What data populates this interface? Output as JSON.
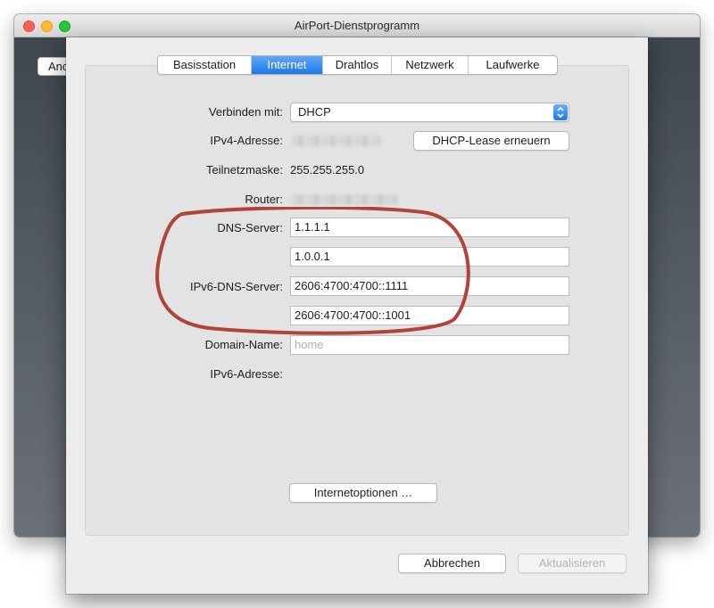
{
  "window": {
    "title": "AirPort-Dienstprogramm",
    "background_button_label": "Anc"
  },
  "tabs": [
    {
      "label": "Basisstation",
      "active": false
    },
    {
      "label": "Internet",
      "active": true
    },
    {
      "label": "Drahtlos",
      "active": false
    },
    {
      "label": "Netzwerk",
      "active": false
    },
    {
      "label": "Laufwerke",
      "active": false
    }
  ],
  "form": {
    "connect_with": {
      "label": "Verbinden mit:",
      "value": "DHCP"
    },
    "ipv4": {
      "label": "IPv4-Adresse:",
      "value_hidden": true
    },
    "renew_button": "DHCP-Lease erneuern",
    "subnet": {
      "label": "Teilnetzmaske:",
      "value": "255.255.255.0"
    },
    "router": {
      "label": "Router:",
      "value_hidden": true
    },
    "dns": {
      "label": "DNS-Server:",
      "values": [
        "1.1.1.1",
        "1.0.0.1"
      ]
    },
    "ipv6_dns": {
      "label": "IPv6-DNS-Server:",
      "values": [
        "2606:4700:4700::1111",
        "2606:4700:4700::1001"
      ]
    },
    "domain": {
      "label": "Domain-Name:",
      "placeholder": "home"
    },
    "ipv6_address": {
      "label": "IPv6-Adresse:"
    }
  },
  "buttons": {
    "internet_options": "Internetoptionen …",
    "cancel": "Abbrechen",
    "update": "Aktualisieren"
  },
  "colors": {
    "accent": "#1f76ec",
    "annotation": "#b0443a"
  }
}
